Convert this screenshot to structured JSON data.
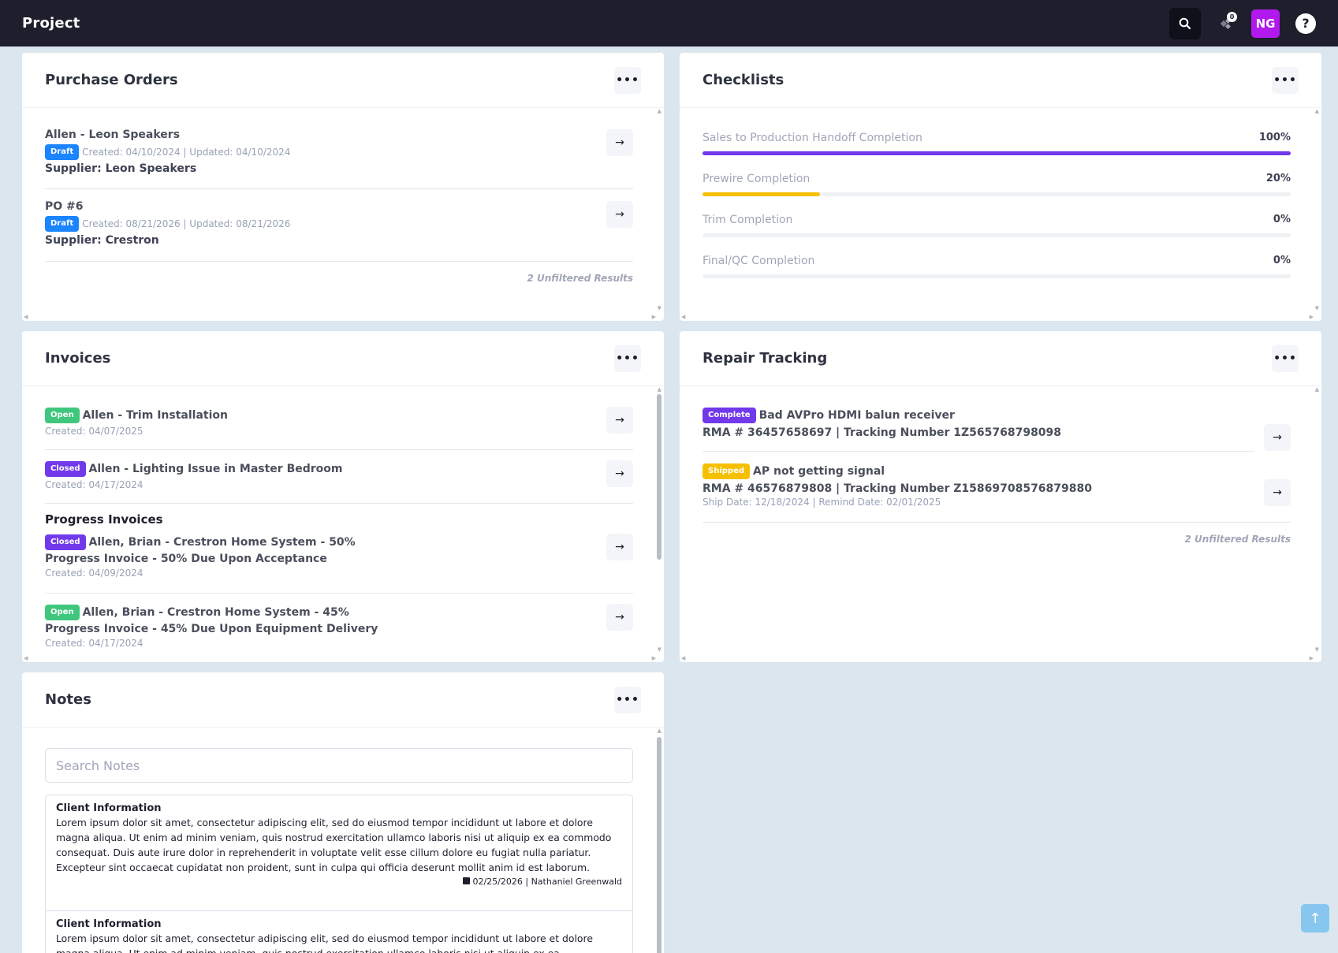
{
  "app": {
    "title": "Project"
  },
  "topbar": {
    "notif_count": "0",
    "avatar_initials": "NG",
    "help_label": "?"
  },
  "purchase_orders": {
    "title": "Purchase Orders",
    "items": [
      {
        "title": "Allen - Leon Speakers",
        "badge": "Draft",
        "dates": "Created: 04/10/2024 | Updated: 04/10/2024",
        "supplier": "Supplier: Leon Speakers"
      },
      {
        "title": "PO #6",
        "badge": "Draft",
        "dates": "Created: 08/21/2026 | Updated: 08/21/2026",
        "supplier": "Supplier: Crestron"
      }
    ],
    "results": "2 Unfiltered Results"
  },
  "checklists": {
    "title": "Checklists",
    "items": [
      {
        "label": "Sales to Production Handoff Completion",
        "pct_label": "100%",
        "value": 100,
        "color": "#7239ea"
      },
      {
        "label": "Prewire Completion",
        "pct_label": "20%",
        "value": 20,
        "color": "#f6c000"
      },
      {
        "label": "Trim Completion",
        "pct_label": "0%",
        "value": 0,
        "color": "#7239ea"
      },
      {
        "label": "Final/QC Completion",
        "pct_label": "0%",
        "value": 0,
        "color": "#7239ea"
      }
    ]
  },
  "invoices": {
    "title": "Invoices",
    "items": [
      {
        "badge": "Open",
        "title": "Allen - Trim Installation",
        "created": "Created: 04/07/2025"
      },
      {
        "badge": "Closed",
        "title": "Allen - Lighting Issue in Master Bedroom",
        "created": "Created: 04/17/2024"
      }
    ],
    "progress_heading": "Progress Invoices",
    "progress_items": [
      {
        "badge": "Closed",
        "title": "Allen, Brian - Crestron Home System - 50%",
        "subtitle": "Progress Invoice - 50% Due Upon Acceptance",
        "created": "Created: 04/09/2024"
      },
      {
        "badge": "Open",
        "title": "Allen, Brian - Crestron Home System - 45%",
        "subtitle": "Progress Invoice - 45% Due Upon Equipment Delivery",
        "created": "Created: 04/17/2024"
      }
    ]
  },
  "repair_tracking": {
    "title": "Repair Tracking",
    "items": [
      {
        "badge": "Complete",
        "title": "Bad AVPro HDMI balun receiver",
        "rma": "RMA # 36457658697 | Tracking Number 1Z565768798098",
        "dates": ""
      },
      {
        "badge": "Shipped",
        "title": "AP not getting signal",
        "rma": "RMA # 46576879808 | Tracking Number Z15869708576879880",
        "dates": "Ship Date: 12/18/2024 | Remind Date: 02/01/2025"
      }
    ],
    "results": "2 Unfiltered Results"
  },
  "notes": {
    "title": "Notes",
    "search_placeholder": "Search Notes",
    "items": [
      {
        "title": "Client Information",
        "text": "Lorem ipsum dolor sit amet, consectetur adipiscing elit, sed do eiusmod tempor incididunt ut labore et dolore magna aliqua. Ut enim ad minim veniam, quis nostrud exercitation ullamco laboris nisi ut aliquip ex ea commodo consequat. Duis aute irure dolor in reprehenderit in voluptate velit esse cillum dolore eu fugiat nulla pariatur. Excepteur sint occaecat cupidatat non proident, sunt in culpa qui officia deserunt mollit anim id est laborum.",
        "meta": "02/25/2026 | Nathaniel Greenwald"
      },
      {
        "title": "Client Information",
        "text": "Lorem ipsum dolor sit amet, consectetur adipiscing elit, sed do eiusmod tempor incididunt ut labore et dolore magna aliqua. Ut enim ad minim veniam, quis nostrud exercitation ullamco laboris nisi ut aliquip ex ea",
        "meta": ""
      }
    ]
  }
}
